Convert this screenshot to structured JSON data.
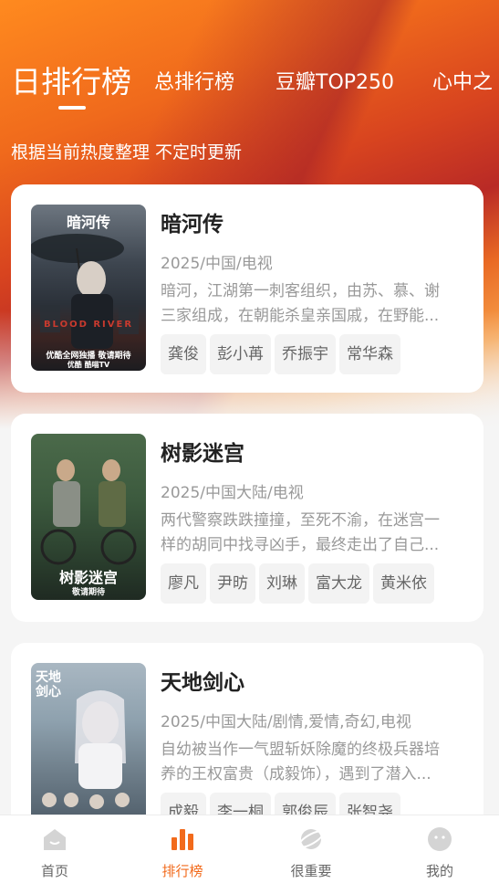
{
  "tabs": [
    "日排行榜",
    "总排行榜",
    "豆瓣TOP250",
    "心中之"
  ],
  "subtitle": "根据当前热度整理 不定时更新",
  "cards": [
    {
      "title": "暗河传",
      "meta": "2025/中国/电视",
      "desc_line1": "暗河，江湖第一刺客组织，由苏、慕、谢",
      "desc_line2": "三家组成，在朝能杀皇亲国戚，在野能...",
      "tags": [
        "龚俊",
        "彭小苒",
        "乔振宇",
        "常华森"
      ],
      "poster": {
        "title": "暗河传",
        "subtitle": "BLOOD RIVER",
        "footer1": "优酷全网独播  敬请期待",
        "footer2": "优酷  酷喵TV"
      }
    },
    {
      "title": "树影迷宫",
      "meta": "2025/中国大陆/电视",
      "desc_line1": "两代警察跌跌撞撞，至死不渝，在迷宫一",
      "desc_line2": "样的胡同中找寻凶手，最终走出了自己...",
      "tags": [
        "廖凡",
        "尹昉",
        "刘琳",
        "富大龙",
        "黄米依"
      ],
      "poster": {
        "title": "树影迷宫",
        "footer1": "敬请期待"
      }
    },
    {
      "title": "天地剑心",
      "meta": "2025/中国大陆/剧情,爱情,奇幻,电视",
      "desc_line1": "自幼被当作一气盟斩妖除魔的终极兵器培",
      "desc_line2": "养的王权富贵（成毅饰），遇到了潜入...",
      "tags": [
        "成毅",
        "李一桐",
        "郭俊辰",
        "张智尧"
      ],
      "poster": {
        "title": "天地剑心"
      }
    }
  ],
  "nav": [
    {
      "label": "首页",
      "icon": "home-icon"
    },
    {
      "label": "排行榜",
      "icon": "ranking-icon"
    },
    {
      "label": "很重要",
      "icon": "planet-icon"
    },
    {
      "label": "我的",
      "icon": "profile-icon"
    }
  ],
  "colors": {
    "accent": "#f26a1b",
    "inactive": "#cfcfcf"
  }
}
